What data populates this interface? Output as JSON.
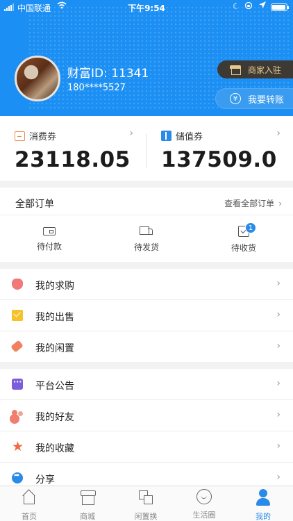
{
  "status_bar": {
    "carrier": "中国联通",
    "wifi_icon": "wifi-icon",
    "time": "下午9:54",
    "battery_icon": "battery-icon"
  },
  "profile": {
    "wealth_id": "财富ID: 11341",
    "phone": "180****5527",
    "merchant_button": "商家入驻",
    "transfer_button": "我要转账",
    "transfer_icon_glyph": "¥"
  },
  "coupons": {
    "consumption": {
      "label": "消费券",
      "value": "23118.05",
      "icon": "coupon-box-icon"
    },
    "stored_value": {
      "label": "储值券",
      "value": "137509.0",
      "icon": "book-icon"
    }
  },
  "orders": {
    "title": "全部订单",
    "view_all": "查看全部订单",
    "items": [
      {
        "label": "待付款",
        "icon": "wallet-icon"
      },
      {
        "label": "待发货",
        "icon": "truck-icon"
      },
      {
        "label": "待收货",
        "icon": "receive-icon",
        "badge": "1"
      }
    ]
  },
  "menu_group_1": [
    {
      "label": "我的求购",
      "icon": "money-bag-icon",
      "color": "#f07878"
    },
    {
      "label": "我的出售",
      "icon": "envelope-icon",
      "color": "#f5c227"
    },
    {
      "label": "我的闲置",
      "icon": "tag-icon",
      "color": "#f08060"
    }
  ],
  "menu_group_2": [
    {
      "label": "平台公告",
      "icon": "chat-icon",
      "color": "#7b5cdb"
    },
    {
      "label": "我的好友",
      "icon": "friends-icon",
      "color": "#ef7d70"
    },
    {
      "label": "我的收藏",
      "icon": "star-icon",
      "color": "#f06a40"
    },
    {
      "label": "分享",
      "icon": "share-icon",
      "color": "#2a8ae8"
    }
  ],
  "chevron": "›",
  "tabbar": [
    {
      "label": "首页",
      "icon": "home-icon",
      "active": false
    },
    {
      "label": "商城",
      "icon": "shop-icon",
      "active": false
    },
    {
      "label": "闲置换",
      "icon": "swap-icon",
      "active": false
    },
    {
      "label": "生活圈",
      "icon": "life-circle-icon",
      "active": false
    },
    {
      "label": "我的",
      "icon": "profile-icon",
      "active": true
    }
  ],
  "colors": {
    "primary": "#1b8ff3",
    "accent": "#2a8ae8",
    "merchant_bg": "#3d3a36",
    "merchant_text": "#e8c98d"
  }
}
